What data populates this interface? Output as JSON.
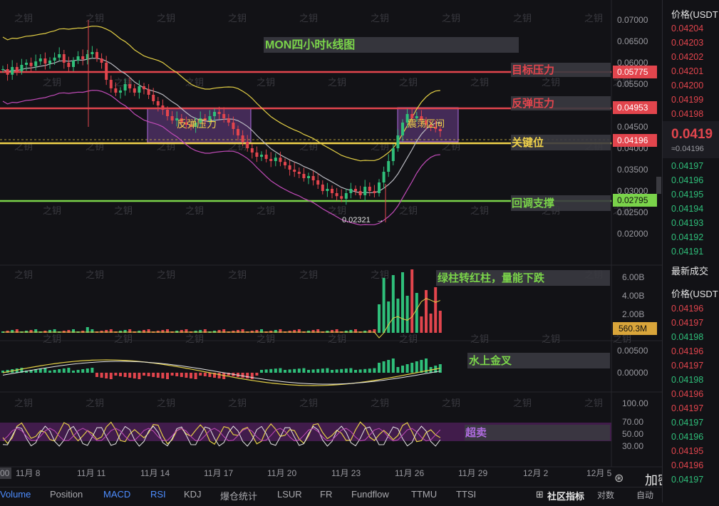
{
  "chart_data": {
    "type": "candlestick",
    "annotations": {
      "title": "MON四小时k线图",
      "target_resist": "目标压力",
      "rebound_resist": "反弹压力",
      "key_level": "关键位",
      "pullback_support": "回调支撑",
      "box1": "反弹压力",
      "box2": "震荡区间",
      "low_label": "0.02321",
      "volume_note": "绿柱转红柱，量能下跌",
      "macd_note": "水上金叉",
      "rsi_note": "超卖"
    },
    "levels": {
      "target": "0.05775",
      "rebound": "0.04953",
      "key": "0.04196",
      "support": "0.02795",
      "volume_tag": "560.3M"
    },
    "price_axis": [
      "0.07000",
      "0.06500",
      "0.06000",
      "0.05500",
      "0.05000",
      "0.04500",
      "0.04000",
      "0.03500",
      "0.03000",
      "0.02500",
      "0.02000"
    ],
    "volume_axis": [
      "6.00B",
      "4.00B",
      "2.00B"
    ],
    "macd_axis": [
      "0.00500",
      "0.00000"
    ],
    "rsi_axis": [
      "100.00",
      "70.00",
      "50.00",
      "30.00"
    ],
    "x_labels": [
      "11月 8",
      "11月 11",
      "11月 14",
      "11月 17",
      "11月 20",
      "11月 23",
      "11月 26",
      "11月 29",
      "12月 2",
      "12月 5"
    ],
    "x_partial": "00",
    "close_series": [
      0.0585,
      0.0572,
      0.059,
      0.058,
      0.0595,
      0.06,
      0.0592,
      0.0603,
      0.061,
      0.0598,
      0.0605,
      0.0612,
      0.062,
      0.06,
      0.059,
      0.0605,
      0.0615,
      0.0608,
      0.062,
      0.0625,
      0.061,
      0.06,
      0.056,
      0.054,
      0.053,
      0.0535,
      0.055,
      0.054,
      0.053,
      0.0545,
      0.0538,
      0.0525,
      0.051,
      0.05,
      0.049,
      0.0475,
      0.0465,
      0.047,
      0.046,
      0.0455,
      0.045,
      0.046,
      0.047,
      0.0465,
      0.0475,
      0.0485,
      0.048,
      0.047,
      0.046,
      0.0445,
      0.043,
      0.0415,
      0.04,
      0.039,
      0.038,
      0.0385,
      0.0375,
      0.037,
      0.0378,
      0.0368,
      0.036,
      0.035,
      0.0345,
      0.034,
      0.033,
      0.0335,
      0.0325,
      0.0315,
      0.03,
      0.0305,
      0.0295,
      0.0288,
      0.0282,
      0.0295,
      0.0305,
      0.03,
      0.029,
      0.031,
      0.03,
      0.0295,
      0.032,
      0.0345,
      0.037,
      0.04,
      0.043,
      0.046,
      0.048,
      0.047,
      0.0475,
      0.0465,
      0.0455,
      0.045,
      0.0445,
      0.044
    ]
  },
  "sidebar": {
    "header1": "价格(USDT",
    "book_asks": [
      "0.04204",
      "0.04203",
      "0.04202",
      "0.04201",
      "0.04200",
      "0.04199",
      "0.04198"
    ],
    "last": "0.0419",
    "last_small": "≈0.04196",
    "book_bids": [
      "0.04197",
      "0.04196",
      "0.04195",
      "0.04194",
      "0.04193",
      "0.04192",
      "0.04191"
    ],
    "trades_title": "最新成交",
    "header2": "价格(USDT",
    "trades": [
      {
        "p": "0.04196",
        "c": "red"
      },
      {
        "p": "0.04197",
        "c": "red"
      },
      {
        "p": "0.04198",
        "c": "grn"
      },
      {
        "p": "0.04196",
        "c": "red"
      },
      {
        "p": "0.04197",
        "c": "red"
      },
      {
        "p": "0.04198",
        "c": "grn"
      },
      {
        "p": "0.04196",
        "c": "red"
      },
      {
        "p": "0.04197",
        "c": "red"
      },
      {
        "p": "0.04197",
        "c": "grn"
      },
      {
        "p": "0.04196",
        "c": "grn"
      },
      {
        "p": "0.04195",
        "c": "red"
      },
      {
        "p": "0.04196",
        "c": "red"
      },
      {
        "p": "0.04197",
        "c": "grn"
      }
    ]
  },
  "toolbar": {
    "tabs": [
      "Volume",
      "Position",
      "MACD",
      "RSI",
      "KDJ",
      "爆仓统计",
      "LSUR",
      "FR",
      "Fundflow",
      "TTMU",
      "TTSI"
    ],
    "community": "社区指标",
    "compare": "对数",
    "auto": "自动",
    "brand": "加密之钥",
    "watermark": "之钥"
  },
  "colors": {
    "up": "#2fbf7a",
    "down": "#e2454d",
    "accent": "#f0d24a",
    "box": "#a35bd2",
    "support": "#7ad34a",
    "blue": "#4d8dff"
  }
}
